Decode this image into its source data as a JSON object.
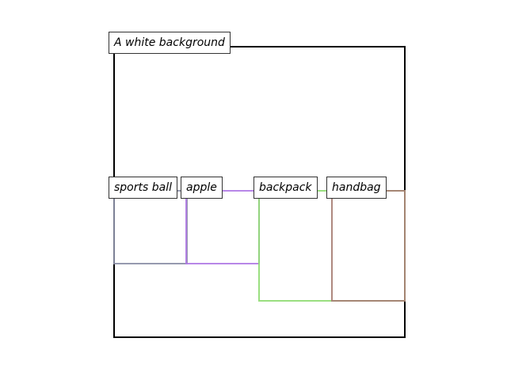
{
  "scene": {
    "caption": "A white background",
    "frame_color": "#000000",
    "objects": [
      {
        "label": "sports ball",
        "color": "#8b8fa6"
      },
      {
        "label": "apple",
        "color": "#b07ae6"
      },
      {
        "label": "backpack",
        "color": "#8fdb72"
      },
      {
        "label": "handbag",
        "color": "#a67c72"
      }
    ]
  }
}
